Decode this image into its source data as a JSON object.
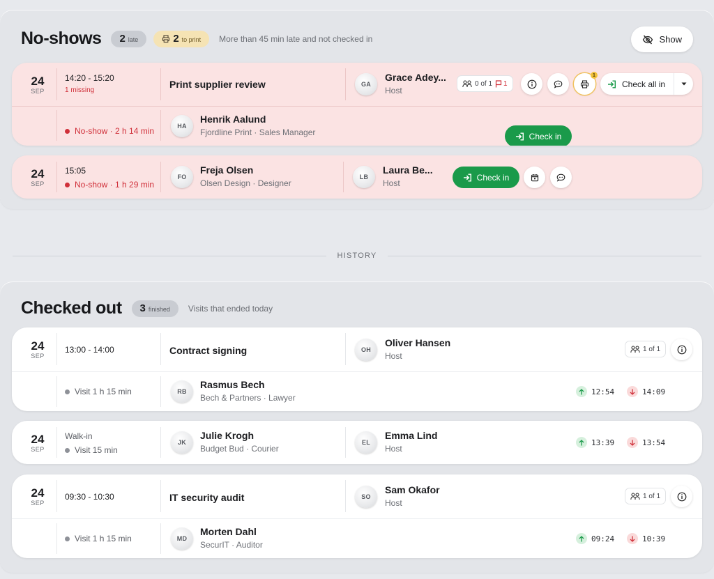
{
  "noshows": {
    "title": "No-shows",
    "late_count": "2",
    "late_label": "late",
    "print_count": "2",
    "print_label": "to print",
    "subtitle": "More than 45 min late and not checked in",
    "show_button": "Show",
    "group": {
      "day": "24",
      "month": "SEP",
      "time": "14:20 - 15:20",
      "missing": "1 missing",
      "title": "Print supplier review",
      "host_initials": "GA",
      "host_name": "Grace Adey...",
      "host_role": "Host",
      "guest_chip": "0 of 1",
      "flag_count": "1",
      "print_badge": "1",
      "check_all_label": "Check all in",
      "visitor": {
        "status": "No-show · 2 h 14 min",
        "initials": "HA",
        "name": "Henrik Aalund",
        "role": "Fjordline Print · Sales Manager",
        "check_in_label": "Check in"
      }
    },
    "single": {
      "day": "24",
      "month": "SEP",
      "time": "15:05",
      "status": "No-show · 1 h 29 min",
      "initials": "FO",
      "name": "Freja Olsen",
      "role": "Olsen Design · Designer",
      "host_initials": "LB",
      "host_name": "Laura Be...",
      "host_role": "Host",
      "check_in_label": "Check in"
    }
  },
  "history_label": "HISTORY",
  "checked_out": {
    "title": "Checked out",
    "count": "3",
    "count_label": "finished",
    "subtitle": "Visits that ended today",
    "visits": [
      {
        "day": "24",
        "month": "SEP",
        "time": "13:00 - 14:00",
        "title": "Contract signing",
        "host_initials": "OH",
        "host_name": "Oliver Hansen",
        "host_role": "Host",
        "guest_chip": "1 of 1",
        "visitor": {
          "status": "Visit 1 h 15 min",
          "initials": "RB",
          "name": "Rasmus Bech",
          "role": "Bech & Partners · Lawyer",
          "in": "12:54",
          "out": "14:09"
        }
      },
      {
        "day": "24",
        "month": "SEP",
        "walkin": "Walk-in",
        "status": "Visit 15 min",
        "initials": "JK",
        "name": "Julie Krogh",
        "role": "Budget Bud · Courier",
        "host_initials": "EL",
        "host_name": "Emma Lind",
        "host_role": "Host",
        "in": "13:39",
        "out": "13:54"
      },
      {
        "day": "24",
        "month": "SEP",
        "time": "09:30 - 10:30",
        "title": "IT security audit",
        "host_initials": "SO",
        "host_name": "Sam Okafor",
        "host_role": "Host",
        "guest_chip": "1 of 1",
        "visitor": {
          "status": "Visit 1 h 15 min",
          "initials": "MD",
          "name": "Morten Dahl",
          "role": "SecurIT · Auditor",
          "in": "09:24",
          "out": "10:39"
        }
      }
    ]
  },
  "colors": {
    "accent_green": "#1a9a4a",
    "no_show_red": "#d0303a",
    "pink_card": "#fbe3e3",
    "print_badge": "#f5e3b4"
  }
}
